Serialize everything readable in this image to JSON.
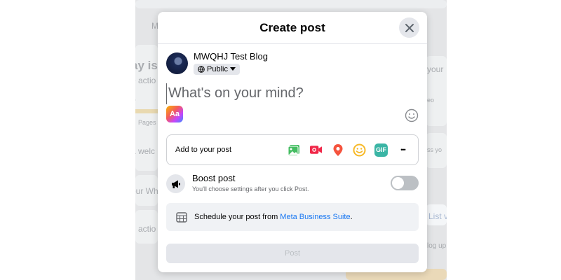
{
  "background": {
    "tab_text": "M",
    "heading_fragment": "ay is y",
    "action_fragment": "e actio",
    "ir_fragment": "ir",
    "pages_fragment": "Pages U",
    "welcome_fragment": "a welc",
    "your_fragment": "our Wh",
    "action2_fragment": "n actio",
    "right_your": "your",
    "right_eo": "eo",
    "right_ss": "ss yo",
    "right_list": "List v",
    "right_blog": "log up"
  },
  "modal": {
    "title": "Create post",
    "author_name": "MWQHJ Test Blog",
    "privacy_label": "Public",
    "composer_placeholder": "What's on your mind?",
    "text_style_label": "Aa",
    "add_to_post_label": "Add to your post",
    "add_icons": [
      "photo-video-icon",
      "live-video-icon",
      "location-icon",
      "feeling-icon",
      "gif-icon",
      "more-icon"
    ],
    "gif_label": "GIF",
    "more_label": "•••",
    "boost_title": "Boost post",
    "boost_description": "You'll choose settings after you click Post.",
    "boost_enabled": false,
    "schedule_prefix": "Schedule your post from ",
    "schedule_link": "Meta Business Suite",
    "schedule_suffix": ".",
    "post_button": "Post"
  },
  "colors": {
    "photo": "#45bd62",
    "live": "#f02849",
    "location": "#f5533d",
    "feeling": "#f7b928",
    "gif": "#3bb5a5",
    "link": "#1877f2"
  }
}
